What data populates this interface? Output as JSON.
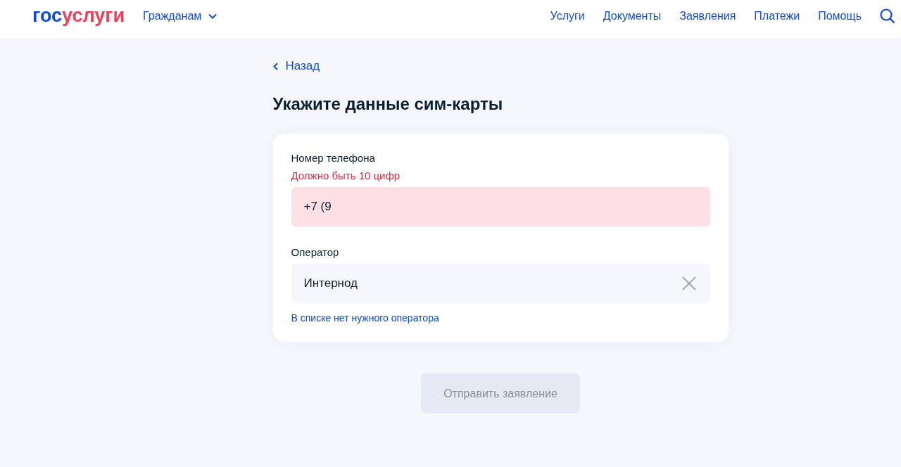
{
  "header": {
    "logo": {
      "prefix": "гос",
      "suffix": "услуги"
    },
    "audience_menu": {
      "label": "Гражданам",
      "expanded": false
    },
    "nav": [
      {
        "label": "Услуги"
      },
      {
        "label": "Документы"
      },
      {
        "label": "Заявления"
      },
      {
        "label": "Платежи"
      },
      {
        "label": "Помощь"
      }
    ]
  },
  "back_link": "Назад",
  "title": "Укажите данные сим-карты",
  "form": {
    "phone": {
      "label": "Номер телефона",
      "error": "Должно быть 10 цифр",
      "value": "+7 (9"
    },
    "operator": {
      "label": "Оператор",
      "value": "Интернод"
    },
    "missing_operator_link": "В списке нет нужного оператора"
  },
  "submit": {
    "label": "Отправить заявление",
    "disabled": true
  }
}
